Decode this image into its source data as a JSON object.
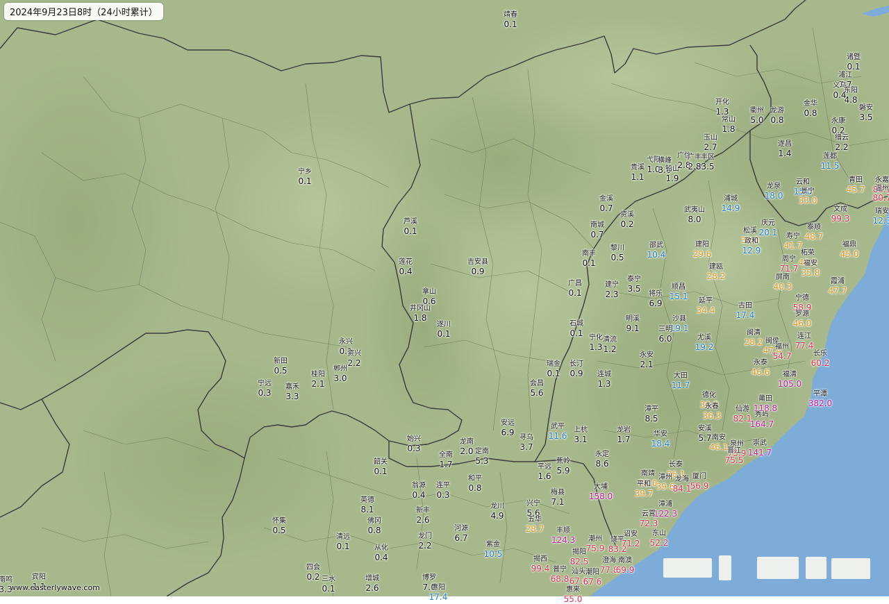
{
  "map": {
    "title": "2024年9月23日8时（24小时累计）",
    "watermark": "www.easterlywave.com",
    "colors": {
      "land": "#a7b98c",
      "sea": "#7eacd8",
      "border": "#3a3a3a",
      "class_0": "#111111",
      "class_1": "#1f7fd0",
      "class_2": "#e69a1e",
      "class_3": "#e0314f",
      "class_4": "#c0199e"
    },
    "stations": [
      {
        "name": "靖春",
        "value": "0.1"
      },
      {
        "name": "诸暨",
        "value": "0.1"
      },
      {
        "name": "浦江",
        "value": "7.7"
      },
      {
        "name": "义乌",
        "value": "0.4"
      },
      {
        "name": "东阳",
        "value": "4.8"
      },
      {
        "name": "开化",
        "value": "1.3"
      },
      {
        "name": "衢州",
        "value": "5.0"
      },
      {
        "name": "龙游",
        "value": "0.8"
      },
      {
        "name": "金华",
        "value": "0.8"
      },
      {
        "name": "磐安",
        "value": "3.5"
      },
      {
        "name": "常山",
        "value": "1.8"
      },
      {
        "name": "永康",
        "value": "0.2"
      },
      {
        "name": "缙云",
        "value": "2.2"
      },
      {
        "name": "玉山",
        "value": "2.7"
      },
      {
        "name": "遂昌",
        "value": "1.4"
      },
      {
        "name": "莲都",
        "value": "11.5"
      },
      {
        "name": "宁乡",
        "value": "0.1"
      },
      {
        "name": "贵溪",
        "value": "1.1"
      },
      {
        "name": "弋阳",
        "value": "1.0"
      },
      {
        "name": "横峰",
        "value": "3.6"
      },
      {
        "name": "铅山",
        "value": "1.9"
      },
      {
        "name": "广信",
        "value": "2.8"
      },
      {
        "name": "广丰",
        "value": "2.8"
      },
      {
        "name": "丰区",
        "value": "3.5"
      },
      {
        "name": "青田",
        "value": "45.7"
      },
      {
        "name": "龙泉",
        "value": "18.0"
      },
      {
        "name": "云和",
        "value": "15.0"
      },
      {
        "name": "景宁",
        "value": "33.0"
      },
      {
        "name": "永嘉",
        "value": "80.7"
      },
      {
        "name": "温州",
        "value": "80.7"
      },
      {
        "name": "金溪",
        "value": "0.7"
      },
      {
        "name": "资溪",
        "value": "0.2"
      },
      {
        "name": "浦城",
        "value": "14.9"
      },
      {
        "name": "武夷山",
        "value": "8.0"
      },
      {
        "name": "文成",
        "value": "99.3"
      },
      {
        "name": "瑞安",
        "value": "12.3"
      },
      {
        "name": "芦溪",
        "value": "0.1"
      },
      {
        "name": "南城",
        "value": "0.7"
      },
      {
        "name": "庆元",
        "value": "20.1"
      },
      {
        "name": "泰顺",
        "value": "48.7"
      },
      {
        "name": "松溪",
        "value": "39.5"
      },
      {
        "name": "政和",
        "value": "12.9"
      },
      {
        "name": "寿宁",
        "value": "41.7"
      },
      {
        "name": "福鼎",
        "value": "45.0"
      },
      {
        "name": "柘荣",
        "value": "43.5"
      },
      {
        "name": "黎川",
        "value": "0.5"
      },
      {
        "name": "邵武",
        "value": "10.4"
      },
      {
        "name": "建阳",
        "value": "29.6"
      },
      {
        "name": "莲花",
        "value": "0.4"
      },
      {
        "name": "吉安县",
        "value": "0.9"
      },
      {
        "name": "南丰",
        "value": "0.1"
      },
      {
        "name": "周宁",
        "value": "71.7"
      },
      {
        "name": "福安",
        "value": "35.8"
      },
      {
        "name": "建瓯",
        "value": "28.2"
      },
      {
        "name": "广昌",
        "value": "0.1"
      },
      {
        "name": "建宁",
        "value": "2.3"
      },
      {
        "name": "泰宁",
        "value": "3.5"
      },
      {
        "name": "屏南",
        "value": "40.3"
      },
      {
        "name": "霞浦",
        "value": "47.7"
      },
      {
        "name": "将乐",
        "value": "6.9"
      },
      {
        "name": "顺昌",
        "value": "15.1"
      },
      {
        "name": "拿山",
        "value": "0.6"
      },
      {
        "name": "井冈山",
        "value": "1.8"
      },
      {
        "name": "延平",
        "value": "34.4"
      },
      {
        "name": "古田",
        "value": "17.4"
      },
      {
        "name": "宁德",
        "value": "58.9"
      },
      {
        "name": "罗源",
        "value": "46.0"
      },
      {
        "name": "石城",
        "value": "0.1"
      },
      {
        "name": "遂川",
        "value": "0.1"
      },
      {
        "name": "明溪",
        "value": "9.1"
      },
      {
        "name": "沙县",
        "value": "19.1"
      },
      {
        "name": "三明",
        "value": "6.0"
      },
      {
        "name": "宁化",
        "value": "1.3"
      },
      {
        "name": "清流",
        "value": "1.2"
      },
      {
        "name": "尤溪",
        "value": "19.2"
      },
      {
        "name": "闽清",
        "value": "28.2"
      },
      {
        "name": "闽侯",
        "value": "47.4"
      },
      {
        "name": "连江",
        "value": "77.4"
      },
      {
        "name": "永兴",
        "value": "0.1"
      },
      {
        "name": "资兴",
        "value": "2.2"
      },
      {
        "name": "福州",
        "value": "54.7"
      },
      {
        "name": "新田",
        "value": "0.5"
      },
      {
        "name": "瑞金",
        "value": "0.1"
      },
      {
        "name": "长汀",
        "value": "0.9"
      },
      {
        "name": "永安",
        "value": "2.1"
      },
      {
        "name": "长乐",
        "value": "60.2"
      },
      {
        "name": "桂阳",
        "value": "2.1"
      },
      {
        "name": "郴州",
        "value": "3.0"
      },
      {
        "name": "永泰",
        "value": "46.6"
      },
      {
        "name": "连城",
        "value": "1.3"
      },
      {
        "name": "大田",
        "value": "11.7"
      },
      {
        "name": "福清",
        "value": "105.0"
      },
      {
        "name": "宁远",
        "value": "0.3"
      },
      {
        "name": "嘉禾",
        "value": "3.3"
      },
      {
        "name": "会昌",
        "value": "5.6"
      },
      {
        "name": "德化",
        "value": "39.0"
      },
      {
        "name": "平潭",
        "value": "382.0"
      },
      {
        "name": "莆田",
        "value": "118.8"
      },
      {
        "name": "永春",
        "value": "36.3"
      },
      {
        "name": "仙游",
        "value": "82.1"
      },
      {
        "name": "秀屿",
        "value": "164.7"
      },
      {
        "name": "漳平",
        "value": "8.5"
      },
      {
        "name": "安远",
        "value": "6.9"
      },
      {
        "name": "武平",
        "value": "11.6"
      },
      {
        "name": "上杭",
        "value": "3.1"
      },
      {
        "name": "龙岩",
        "value": "1.7"
      },
      {
        "name": "安溪",
        "value": "5.7"
      },
      {
        "name": "华安",
        "value": "18.4"
      },
      {
        "name": "寻乌",
        "value": "3.7"
      },
      {
        "name": "始兴",
        "value": "0.3"
      },
      {
        "name": "龙南",
        "value": "2.0"
      },
      {
        "name": "全南",
        "value": "1.7"
      },
      {
        "name": "定南",
        "value": "5.3"
      },
      {
        "name": "南安",
        "value": "46.1"
      },
      {
        "name": "泉州",
        "value": "75.9"
      },
      {
        "name": "崇武",
        "value": "141.7"
      },
      {
        "name": "晋江",
        "value": "75.5"
      },
      {
        "name": "永定",
        "value": "8.6"
      },
      {
        "name": "韶关",
        "value": "0.1"
      },
      {
        "name": "平远",
        "value": "1.6"
      },
      {
        "name": "蕉岭",
        "value": "5.9"
      },
      {
        "name": "南靖",
        "value": "35.0"
      },
      {
        "name": "长泰",
        "value": "36.1"
      },
      {
        "name": "漳州",
        "value": "39.6"
      },
      {
        "name": "翁源",
        "value": "0.4"
      },
      {
        "name": "连平",
        "value": "0.3"
      },
      {
        "name": "和平",
        "value": "0.8"
      },
      {
        "name": "平和",
        "value": "39.7"
      },
      {
        "name": "龙海",
        "value": "84.1"
      },
      {
        "name": "厦门",
        "value": "56.9"
      },
      {
        "name": "大埔",
        "value": "158.0"
      },
      {
        "name": "梅县",
        "value": "7.1"
      },
      {
        "name": "英德",
        "value": "8.1"
      },
      {
        "name": "龙川",
        "value": "4.9"
      },
      {
        "name": "兴宁",
        "value": "5.6"
      },
      {
        "name": "新丰",
        "value": "2.6"
      },
      {
        "name": "漳浦",
        "value": "122.3"
      },
      {
        "name": "五华",
        "value": "28.7"
      },
      {
        "name": "云霄",
        "value": "72.3"
      },
      {
        "name": "怀集",
        "value": "0.5"
      },
      {
        "name": "佛冈",
        "value": "0.8"
      },
      {
        "name": "河源",
        "value": "6.7"
      },
      {
        "name": "丰顺",
        "value": "124.3"
      },
      {
        "name": "潮州",
        "value": "75.9"
      },
      {
        "name": "饶平",
        "value": "83.2"
      },
      {
        "name": "诏安",
        "value": "71.2"
      },
      {
        "name": "东山",
        "value": "52.2"
      },
      {
        "name": "清远",
        "value": "0.1"
      },
      {
        "name": "龙门",
        "value": "2.2"
      },
      {
        "name": "紫金",
        "value": "10.5"
      },
      {
        "name": "揭阳",
        "value": "82.5"
      },
      {
        "name": "从化",
        "value": "0.4"
      },
      {
        "name": "澄海",
        "value": "77.8"
      },
      {
        "name": "南澳",
        "value": "69.9"
      },
      {
        "name": "揭西",
        "value": "99.4"
      },
      {
        "name": "汕头",
        "value": "67.6"
      },
      {
        "name": "四会",
        "value": "0.2"
      },
      {
        "name": "普宁",
        "value": "68.8"
      },
      {
        "name": "潮阳",
        "value": "67.6"
      },
      {
        "name": "宾阳",
        "value": "1.1"
      },
      {
        "name": "三水",
        "value": "0.1"
      },
      {
        "name": "增城",
        "value": "2.6"
      },
      {
        "name": "博罗",
        "value": "7.0"
      },
      {
        "name": "惠阳",
        "value": "17.4"
      },
      {
        "name": "惠来",
        "value": "55.0"
      },
      {
        "name": "南鸣",
        "value": "3.3"
      }
    ]
  }
}
